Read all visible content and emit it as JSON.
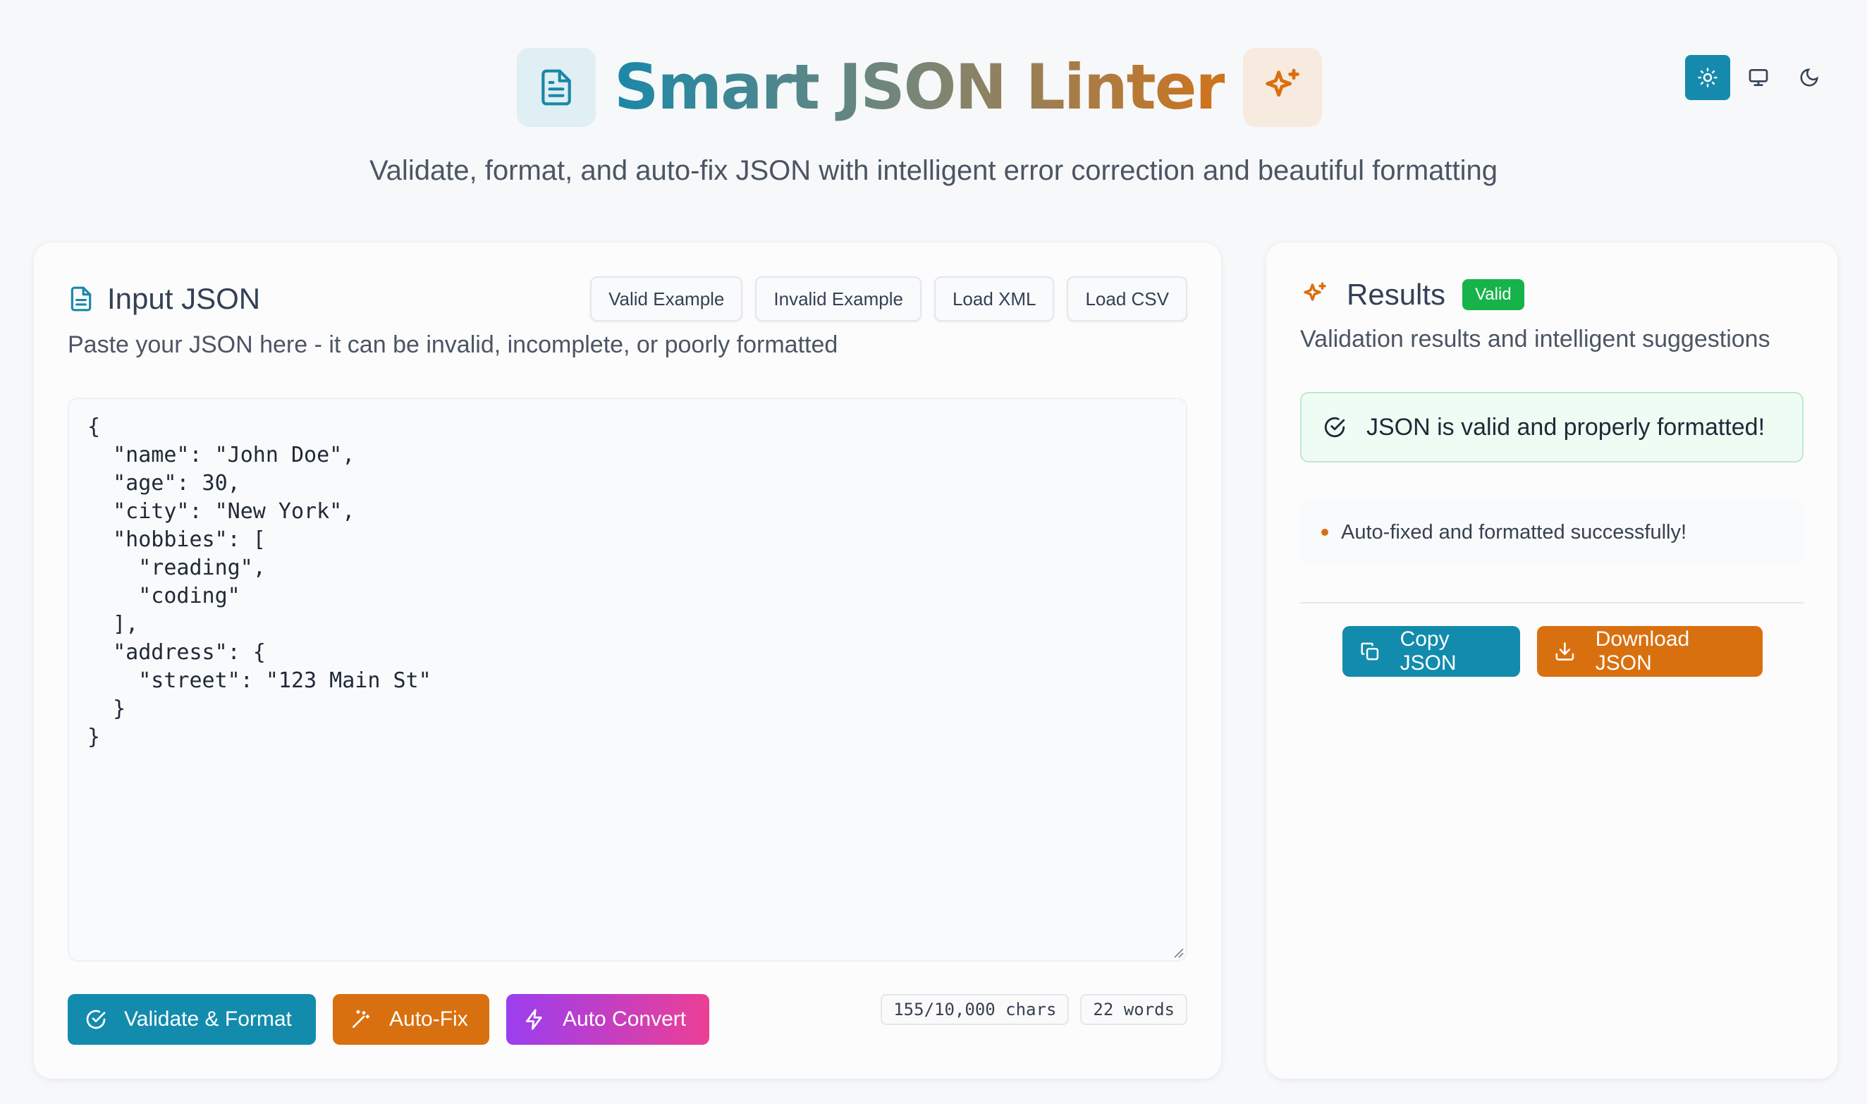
{
  "header": {
    "title": "Smart JSON Linter",
    "subtitle": "Validate, format, and auto-fix JSON with intelligent error correction and beautiful formatting",
    "logo_icon": "document-icon",
    "sparkle_icon": "sparkles-icon"
  },
  "theme_switch": {
    "options": [
      "light",
      "system",
      "dark"
    ],
    "selected": "light"
  },
  "input_panel": {
    "title": "Input JSON",
    "description": "Paste your JSON here - it can be invalid, incomplete, or poorly formatted",
    "example_buttons": [
      "Valid Example",
      "Invalid Example",
      "Load XML",
      "Load CSV"
    ],
    "editor_value": "{\n  \"name\": \"John Doe\",\n  \"age\": 30,\n  \"city\": \"New York\",\n  \"hobbies\": [\n    \"reading\",\n    \"coding\"\n  ],\n  \"address\": {\n    \"street\": \"123 Main St\"\n  }\n}",
    "actions": {
      "validate": "Validate & Format",
      "autofix": "Auto-Fix",
      "convert": "Auto Convert"
    },
    "stats": {
      "chars": "155/10,000 chars",
      "words": "22 words"
    }
  },
  "results_panel": {
    "title": "Results",
    "status_badge": "Valid",
    "description": "Validation results and intelligent suggestions",
    "alert": "JSON is valid and properly formatted!",
    "notes": [
      "Auto-fixed and formatted successfully!"
    ],
    "copy_label": "Copy JSON",
    "download_label": "Download JSON"
  },
  "colors": {
    "accent_teal": "#138bad",
    "accent_orange": "#d9700f",
    "success_green": "#16b34a",
    "gradient_purple": "#9b3ef0",
    "gradient_pink": "#ec3f95"
  }
}
